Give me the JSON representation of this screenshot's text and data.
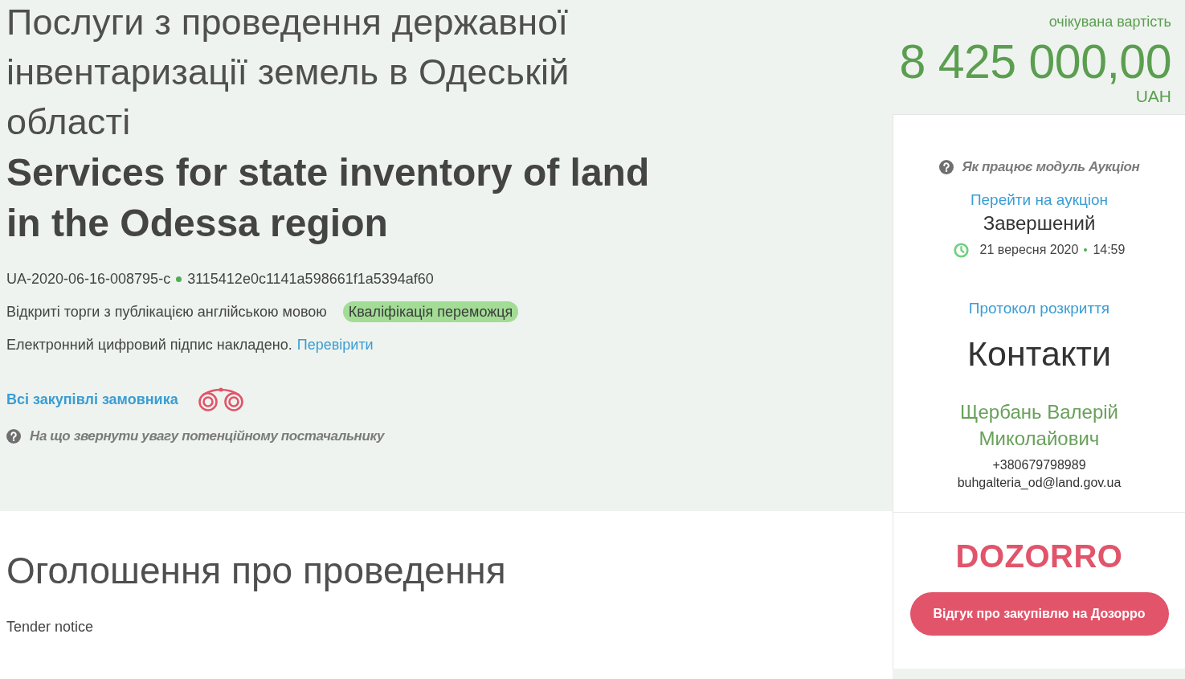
{
  "title_uk": "Послуги з проведення державної інвентаризації земель в Одеській області",
  "title_en": "Services for state inventory of land in the Odessa region",
  "identifiers": {
    "tender_id": "UA-2020-06-16-008795-c",
    "hash": "3115412e0c1141a598661f1a5394af60"
  },
  "procedure": {
    "type": "Відкриті торги з публікацією англійською мовою",
    "status_badge": "Кваліфікація переможця"
  },
  "signature": {
    "text": "Електронний цифровий підпис накладено.",
    "link": "Перевірити"
  },
  "buyer_link": "Всі закупівлі замовника",
  "hint": "На що звернути увагу потенційному постачальнику",
  "notice": {
    "heading": "Оголошення про проведення",
    "subheading": "Tender notice"
  },
  "price": {
    "label": "очікувана вартість",
    "amount": "8 425 000,00",
    "currency": "UAH"
  },
  "auction": {
    "help": "Як працює модуль Аукціон",
    "link": "Перейти на аукціон",
    "status": "Завершений",
    "date": "21 вересня 2020",
    "time": "14:59",
    "protocol_link": "Протокол розкриття"
  },
  "contacts": {
    "heading": "Контакти",
    "name": "Щербань Валерій Миколайович",
    "phone": "+380679798989",
    "email": "buhgalteria_od@land.gov.ua"
  },
  "dozorro": {
    "logo": "DOZORRO",
    "button": "Відгук про закупівлю на Дозорро"
  }
}
